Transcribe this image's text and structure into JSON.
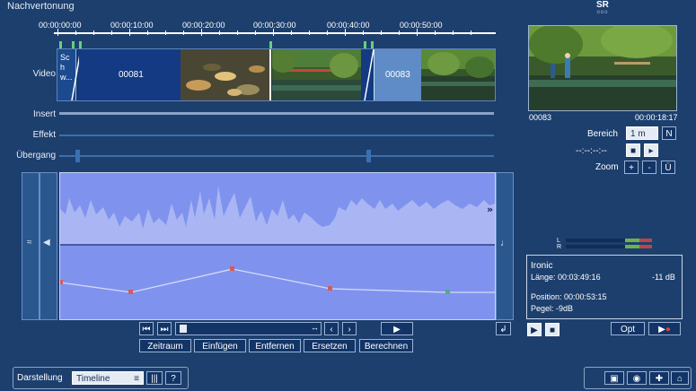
{
  "app": {
    "title": "Nachvertonung",
    "logo": "SR",
    "logo_sub": "ooo"
  },
  "ruler": {
    "ticks": [
      "00:00:00:00",
      "00:00:10:00",
      "00:00:20:00",
      "00:00:30:00",
      "00:00:40:00",
      "00:00:50:00"
    ]
  },
  "tracks": {
    "video_label": "Video",
    "insert_label": "Insert",
    "effekt_label": "Effekt",
    "uebergang_label": "Übergang",
    "clip1_vertical": "Schw...",
    "clip2_name": "00081",
    "clip3_name": "00083"
  },
  "preview": {
    "clip": "00083",
    "time": "00:00:18:17"
  },
  "controls": {
    "bereich_label": "Bereich",
    "bereich_value": "1 m",
    "n_label": "N",
    "timecode_placeholder": "--:--:--:--",
    "zoom_label": "Zoom",
    "zoom_plus": "+",
    "zoom_minus": "-",
    "zoom_u": "Ü"
  },
  "meter": {
    "l": "L",
    "r": "R"
  },
  "info": {
    "name": "Ironic",
    "laenge": "Länge: 00:03:49:16",
    "level": "-11 dB",
    "position": "Position: 00:00:53:15",
    "pegel": "Pegel: -9dB"
  },
  "buttons": {
    "zeitraum": "Zeitraum",
    "einfuegen": "Einfügen",
    "entfernen": "Entfernen",
    "ersetzen": "Ersetzen",
    "berechnen": "Berechnen",
    "opt": "Opt"
  },
  "bottom": {
    "darstellung_label": "Darstellung",
    "view_value": "Timeline"
  },
  "colors": {
    "background": "#1d3f6d",
    "audio_panel": "#7f93ee",
    "waveform": "#aab6f3",
    "envelope": "#d6dcf8",
    "marker_red": "#d85a58",
    "marker_green": "#49b27a"
  }
}
